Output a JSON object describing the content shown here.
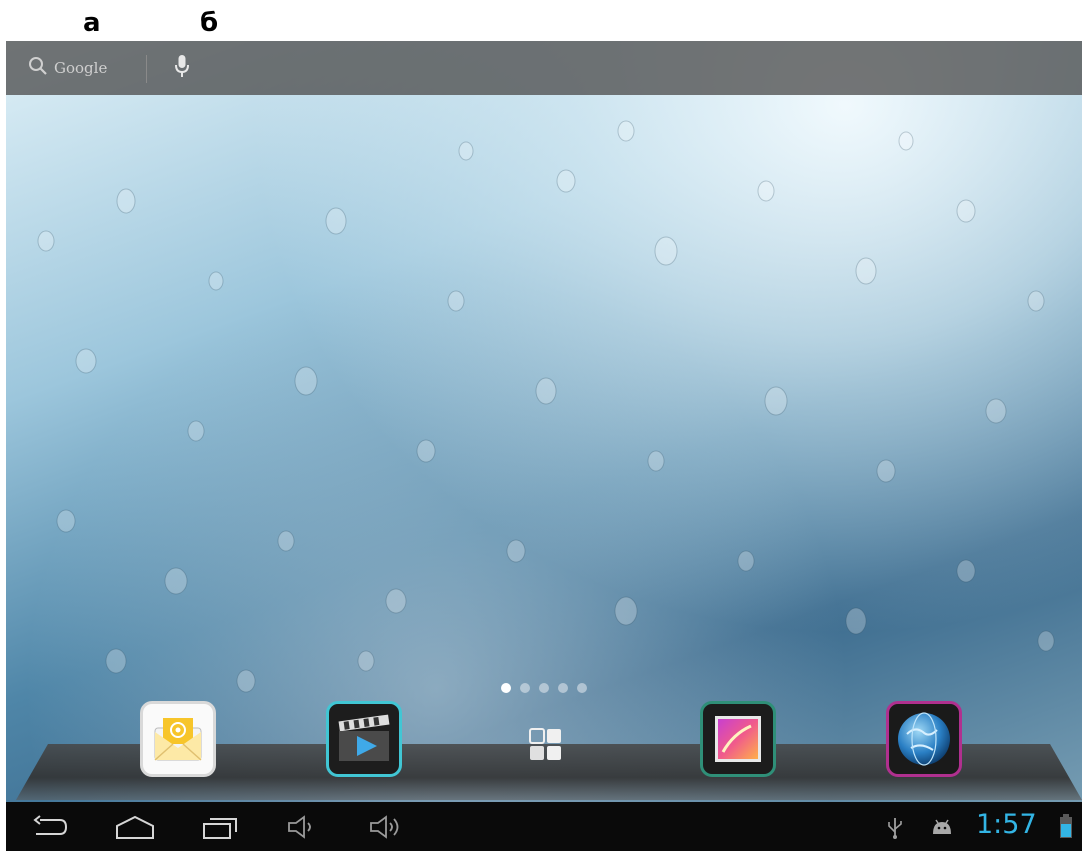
{
  "labels": {
    "a": "а",
    "b": "б"
  },
  "search_bar": {
    "google_text": "Google",
    "icons": [
      "search-icon",
      "microphone-icon"
    ]
  },
  "page_indicator": {
    "count": 5,
    "active_index": 0
  },
  "dock": {
    "apps": [
      {
        "name": "email-app",
        "icon": "email-envelope-icon"
      },
      {
        "name": "video-app",
        "icon": "video-clapper-icon"
      },
      {
        "name": "apps-launcher",
        "icon": "grid-icon"
      },
      {
        "name": "gallery-app",
        "icon": "gallery-image-icon"
      },
      {
        "name": "browser-app",
        "icon": "globe-icon"
      }
    ]
  },
  "navigation_bar": {
    "buttons": [
      "back-icon",
      "home-icon",
      "recent-apps-icon",
      "volume-down-icon",
      "volume-up-icon"
    ]
  },
  "status": {
    "time": "1:57",
    "icons": [
      "usb-icon",
      "android-debug-icon",
      "battery-icon"
    ]
  },
  "colors": {
    "clock": "#33b5e5",
    "video_border": "#41c6d4",
    "gallery_border": "#2f8f78",
    "browser_border": "#b0308f"
  }
}
